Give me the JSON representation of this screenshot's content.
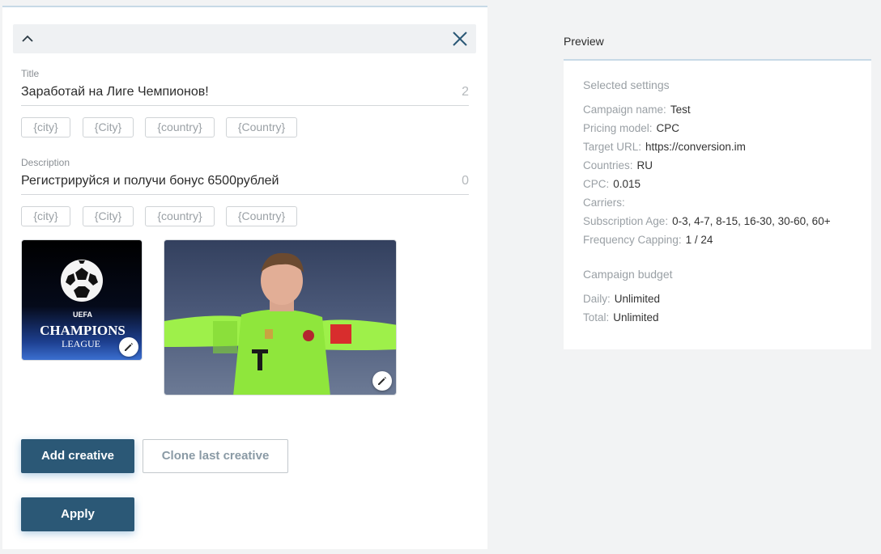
{
  "editor": {
    "title_field": {
      "label": "Title",
      "value": "Заработай на Лиге Чемпионов!",
      "count": "2",
      "chips": [
        "{city}",
        "{City}",
        "{country}",
        "{Country}"
      ]
    },
    "description_field": {
      "label": "Description",
      "value": "Регистрируйся и получи бонус 6500рублей",
      "count": "0",
      "chips": [
        "{city}",
        "{City}",
        "{country}",
        "{Country}"
      ]
    },
    "buttons": {
      "add_creative": "Add creative",
      "clone_last_creative": "Clone last creative",
      "apply": "Apply"
    },
    "images": {
      "logo_text_uefa": "UEFA",
      "logo_text_champions": "CHAMPIONS",
      "logo_text_league": "LEAGUE"
    }
  },
  "preview": {
    "title": "Preview",
    "selected_settings": {
      "heading": "Selected settings",
      "rows": [
        {
          "key": "Campaign name:",
          "value": "Test"
        },
        {
          "key": "Pricing model:",
          "value": "CPC"
        },
        {
          "key": "Target URL:",
          "value": "https://conversion.im"
        },
        {
          "key": "Countries:",
          "value": "RU"
        },
        {
          "key": "CPC:",
          "value": "0.015"
        },
        {
          "key": "Carriers:",
          "value": ""
        },
        {
          "key": "Subscription Age:",
          "value": "0-3, 4-7, 8-15, 16-30, 30-60, 60+"
        },
        {
          "key": "Frequency Capping:",
          "value": "1 / 24"
        }
      ]
    },
    "campaign_budget": {
      "heading": "Campaign budget",
      "rows": [
        {
          "key": "Daily:",
          "value": "Unlimited"
        },
        {
          "key": "Total:",
          "value": "Unlimited"
        }
      ]
    }
  },
  "colors": {
    "primary": "#2b5876",
    "accent_line": "#c7d9e6"
  }
}
